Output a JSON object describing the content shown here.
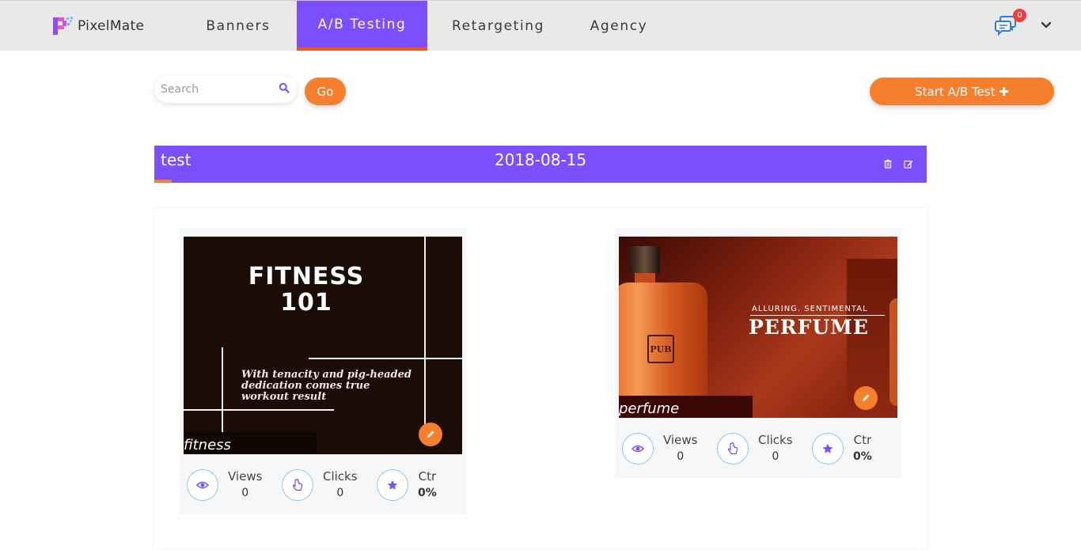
{
  "brand": {
    "name": "PixelMate"
  },
  "nav": {
    "tabs": [
      {
        "label": "Banners"
      },
      {
        "label": "A/B Testing",
        "active": true
      },
      {
        "label": "Retargeting"
      },
      {
        "label": "Agency"
      }
    ],
    "notifications_count": "0"
  },
  "toolbar": {
    "search_placeholder": "Search",
    "go_label": "Go",
    "start_label": "Start A/B Test ✚"
  },
  "test": {
    "name": "test",
    "date": "2018-08-15"
  },
  "variants": [
    {
      "label": "fitness",
      "banner": {
        "title_line1": "FITNESS",
        "title_line2": "101",
        "quote": "With tenacity and pig-headed dedication comes true workout result"
      },
      "stats": [
        {
          "label": "Views",
          "value": "0",
          "icon": "eye-icon"
        },
        {
          "label": "Clicks",
          "value": "0",
          "icon": "pointer-icon"
        },
        {
          "label": "Ctr",
          "value": "0%",
          "icon": "star-icon"
        }
      ]
    },
    {
      "label": "perfume",
      "banner": {
        "subtitle": "ALLURING. SENTIMENTAL",
        "title": "PERFUME",
        "bottle_brand": "PUB"
      },
      "stats": [
        {
          "label": "Views",
          "value": "0",
          "icon": "eye-icon"
        },
        {
          "label": "Clicks",
          "value": "0",
          "icon": "pointer-icon"
        },
        {
          "label": "Ctr",
          "value": "0%",
          "icon": "star-icon"
        }
      ]
    }
  ],
  "colors": {
    "accent": "#7b4ffe",
    "orange": "#f57f2c",
    "badge": "#ef3e3e"
  }
}
